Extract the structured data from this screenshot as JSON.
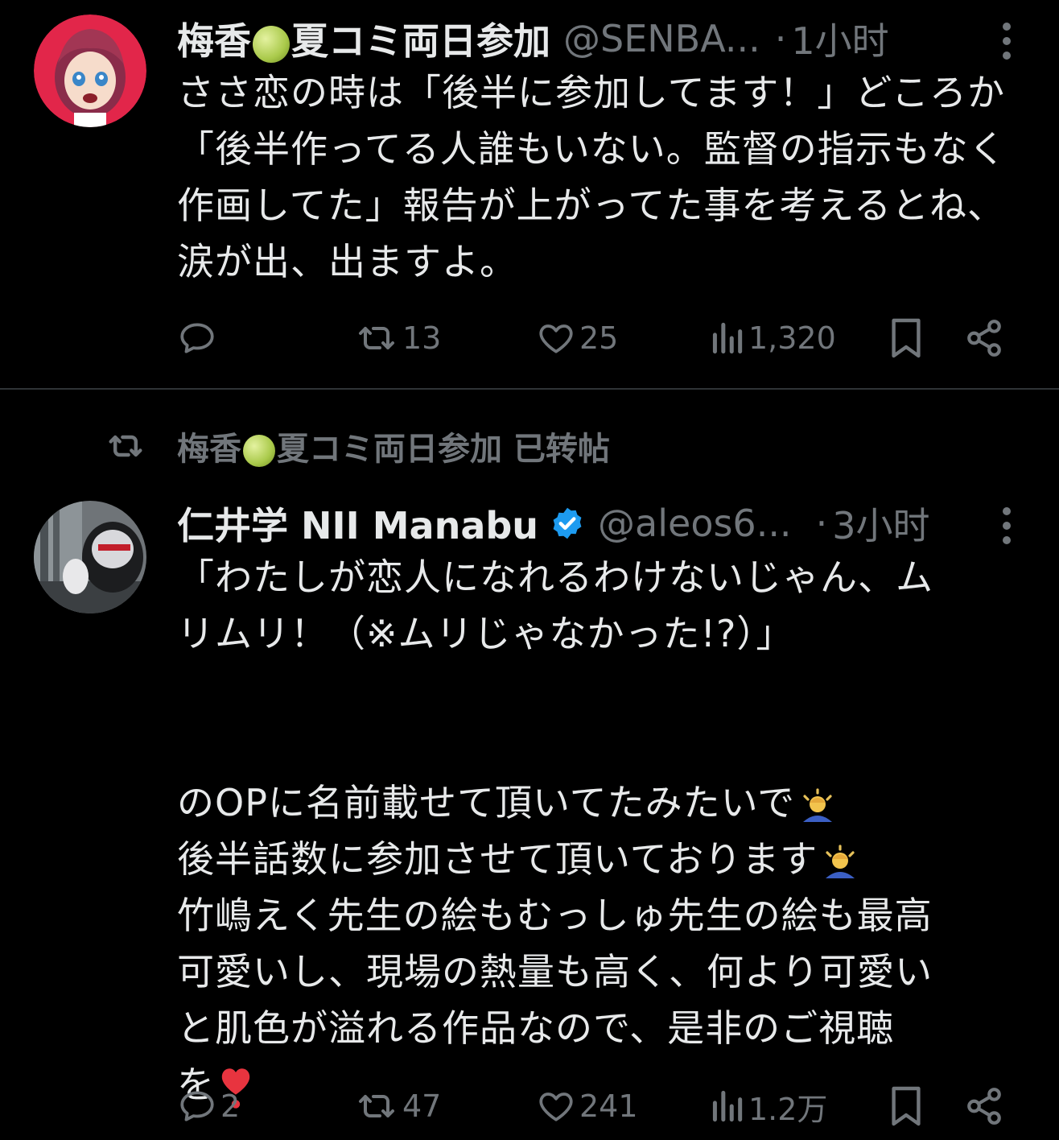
{
  "tweet1": {
    "name_prefix": "梅香",
    "name_suffix": "夏コミ両日参加",
    "handle": "@SENBA...",
    "separator": "·",
    "time": "1小时",
    "text": "ささ恋の時は「後半に参加してます！」どころか「後半作ってる人誰もいない。監督の指示もなく作画してた」報告が上がってた事を考えるとね、涙が出、出ますよ。",
    "stats": {
      "replies": "",
      "retweets": "13",
      "likes": "25",
      "views": "1,320"
    }
  },
  "retweet_banner": {
    "name_prefix": "梅香",
    "name_suffix": "夏コミ両日参加",
    "label": "已转帖"
  },
  "tweet2": {
    "name": "仁井学 NII Manabu",
    "handle": "@aleos6...",
    "separator": "·",
    "time": "3小时",
    "text_line1": "「わたしが恋人になれるわけないじゃん、ム",
    "text_line2": "リムリ！（※ムリじゃなかった!?）」",
    "text_line3": "のOPに名前載せて頂いてたみたいで",
    "text_line4": "後半話数に参加させて頂いております",
    "text_line5": "竹嶋えく先生の絵もむっしゅ先生の絵も最高",
    "text_line6": "可愛いし、現場の熱量も高く、何より可愛い",
    "text_line7": "と肌色が溢れる作品なので、是非のご視聴",
    "text_line8": "を",
    "stats": {
      "replies": "2",
      "retweets": "47",
      "likes": "241",
      "views": "1.2万"
    }
  },
  "icons": {
    "reply": "reply-icon",
    "retweet": "retweet-icon",
    "like": "heart-icon",
    "views": "views-icon",
    "bookmark": "bookmark-icon",
    "share": "share-icon",
    "more": "more-icon",
    "verified": "verified-badge-icon",
    "melon": "melon-emoji",
    "bowing": "bowing-person-emoji",
    "red_heart": "heart-exclamation-emoji"
  },
  "colors": {
    "background": "#000000",
    "text": "#e7e9ea",
    "muted": "#71767b",
    "verified": "#1d9bf0"
  }
}
